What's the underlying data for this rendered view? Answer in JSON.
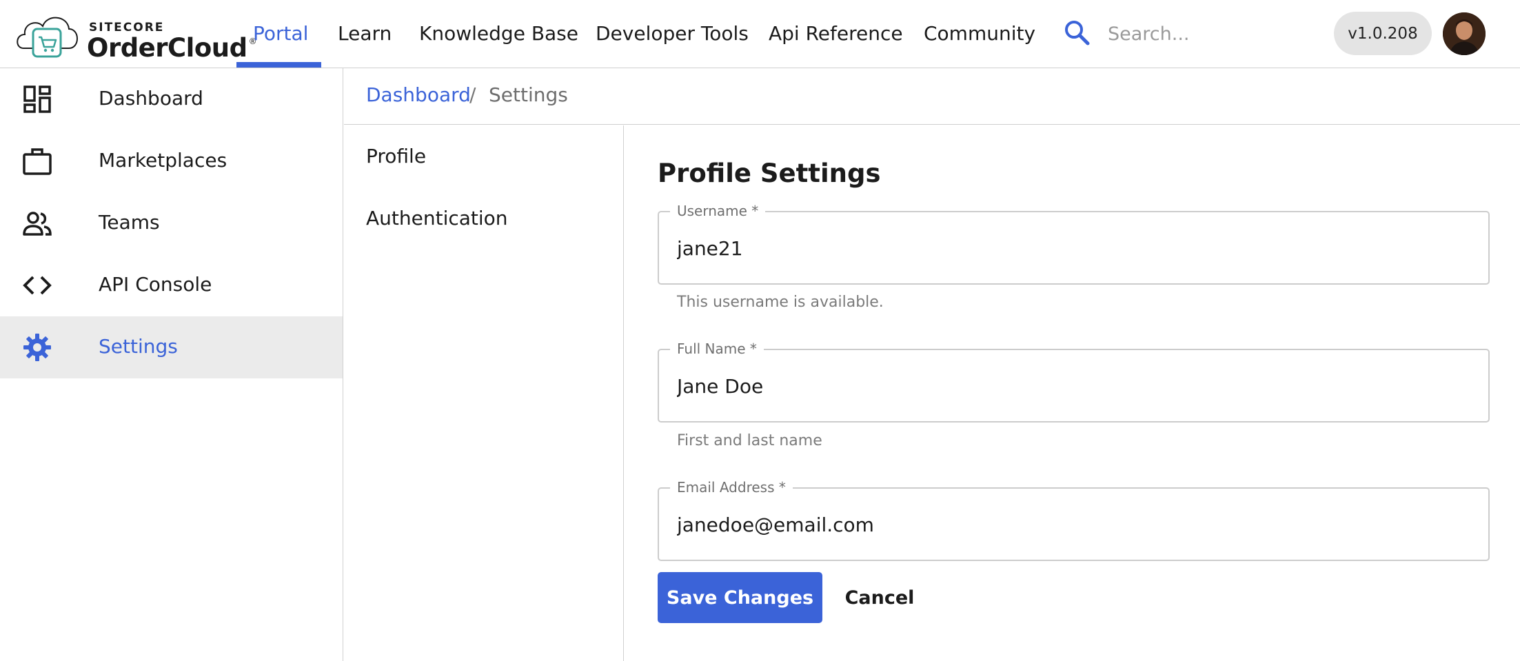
{
  "brand": {
    "small_text": "SITECORE",
    "big_text": "OrderCloud",
    "registered_mark": "®",
    "accent_color": "#3b63d8",
    "logo_teal": "#3aa39a"
  },
  "topnav": {
    "items": [
      {
        "label": "Portal",
        "active": true
      },
      {
        "label": "Learn",
        "active": false
      },
      {
        "label": "Knowledge Base",
        "active": false
      },
      {
        "label": "Developer Tools",
        "active": false
      },
      {
        "label": "Api Reference",
        "active": false
      },
      {
        "label": "Community",
        "active": false
      }
    ],
    "search_placeholder": "Search...",
    "version": "v1.0.208"
  },
  "sidebar": {
    "items": [
      {
        "label": "Dashboard",
        "icon": "dashboard-icon",
        "selected": false
      },
      {
        "label": "Marketplaces",
        "icon": "briefcase-icon",
        "selected": false
      },
      {
        "label": "Teams",
        "icon": "people-icon",
        "selected": false
      },
      {
        "label": "API Console",
        "icon": "code-icon",
        "selected": false
      },
      {
        "label": "Settings",
        "icon": "gear-icon",
        "selected": true
      }
    ]
  },
  "breadcrumb": {
    "parent": "Dashboard",
    "separator": "/",
    "current": "Settings"
  },
  "subnav": {
    "items": [
      {
        "label": "Profile"
      },
      {
        "label": "Authentication"
      }
    ]
  },
  "form": {
    "title": "Profile Settings",
    "username": {
      "label": "Username *",
      "value": "jane21",
      "helper": "This username is available."
    },
    "fullname": {
      "label": "Full Name *",
      "value": "Jane Doe",
      "helper": "First and last name"
    },
    "email": {
      "label": "Email Address *",
      "value": "janedoe@email.com"
    },
    "save_label": "Save Changes",
    "cancel_label": "Cancel"
  }
}
